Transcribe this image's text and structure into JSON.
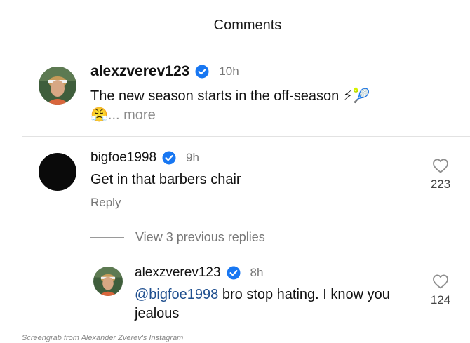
{
  "header": {
    "title": "Comments"
  },
  "post": {
    "username": "alexzverev123",
    "time": "10h",
    "caption_line1": "The new season starts in the off-season ⚡🎾",
    "caption_line2_emoji": "😤",
    "more_label": "... more"
  },
  "comment": {
    "username": "bigfoe1998",
    "time": "9h",
    "text": "Get in that barbers chair",
    "reply_label": "Reply",
    "like_count": "223",
    "view_replies_label": "View 3 previous replies"
  },
  "reply": {
    "username": "alexzverev123",
    "time": "8h",
    "mention": "@bigfoe1998",
    "text_rest": " bro stop hating. I know you",
    "text_line2": "jealous",
    "like_count": "124"
  },
  "credit": "Screengrab from Alexander Zverev's Instagram",
  "colors": {
    "verified": "#1877f2",
    "mention": "#1f4f8f",
    "muted": "#777777"
  },
  "icons": [
    "verified-badge-icon",
    "heart-outline-icon"
  ]
}
